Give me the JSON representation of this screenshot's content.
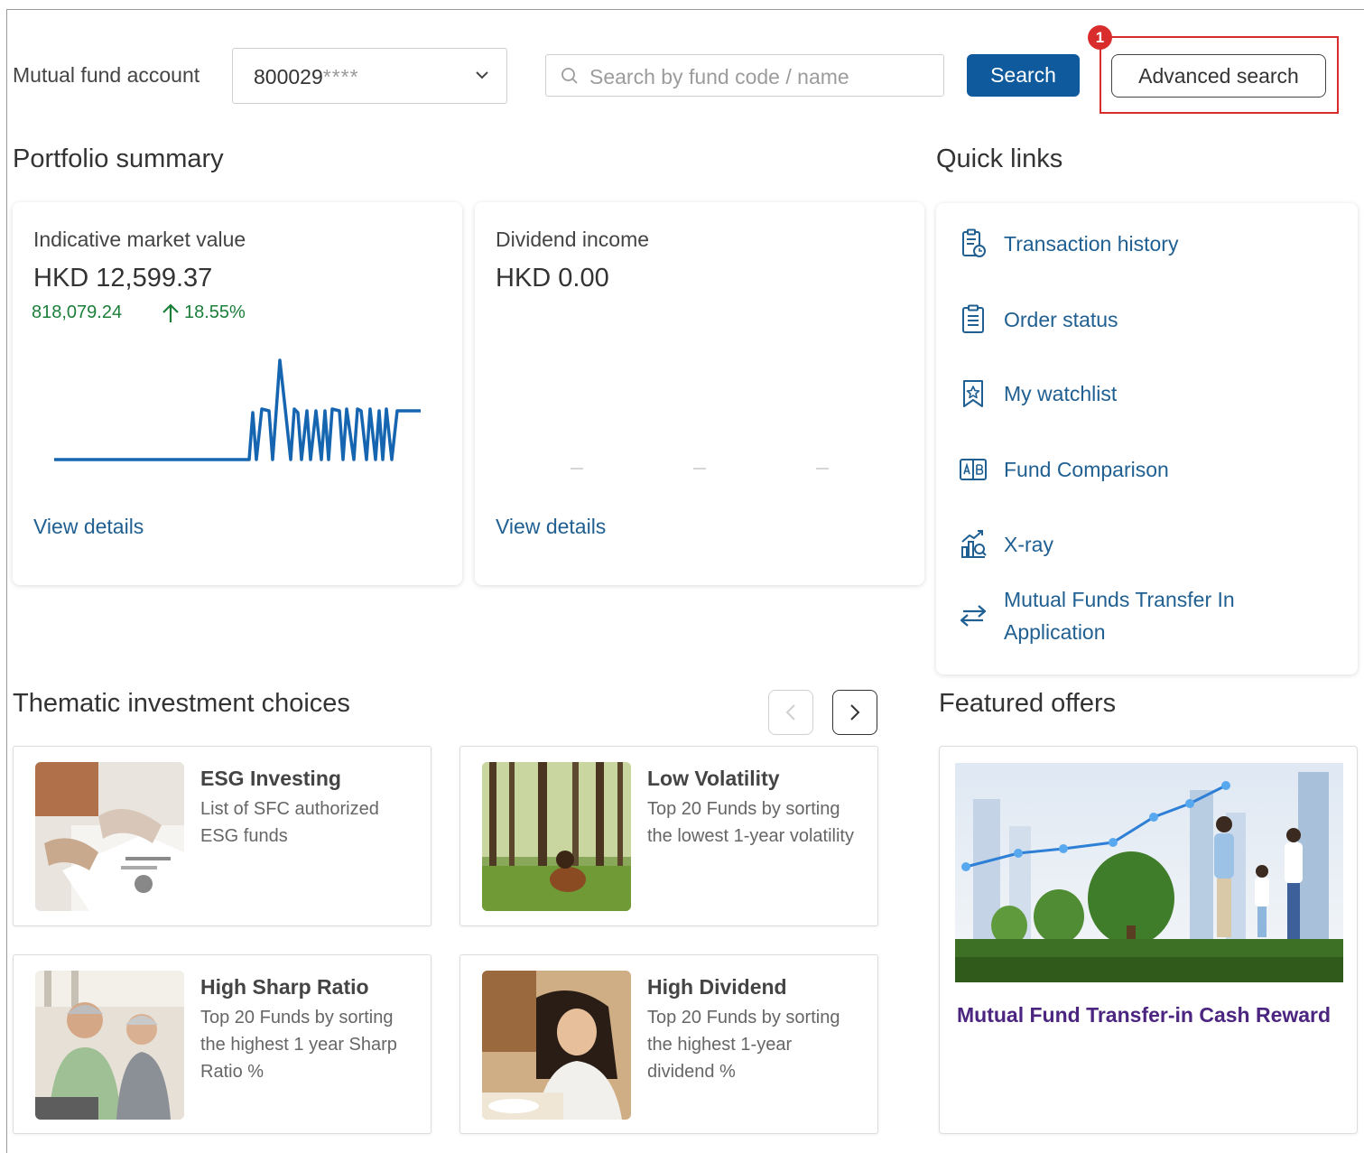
{
  "account": {
    "label": "Mutual fund account",
    "value": "800029",
    "mask": "****"
  },
  "search": {
    "placeholder": "Search by fund code / name",
    "button_label": "Search",
    "advanced_label": "Advanced search",
    "step_number": "1",
    "highlight_color": "#d92c2c"
  },
  "portfolio": {
    "heading": "Portfolio summary",
    "market_value": {
      "title": "Indicative market value",
      "value": "HKD 12,599.37",
      "change": "818,079.24",
      "change_pct": "18.55%",
      "link": "View details"
    },
    "dividend": {
      "title": "Dividend income",
      "value": "HKD 0.00",
      "link": "View details"
    }
  },
  "quick_links": {
    "heading": "Quick links",
    "items": [
      {
        "label": "Transaction history",
        "icon": "transaction-history-icon"
      },
      {
        "label": "Order status",
        "icon": "clipboard-list-icon"
      },
      {
        "label": "My watchlist",
        "icon": "bookmark-star-icon"
      },
      {
        "label": "Fund Comparison",
        "icon": "compare-ab-icon"
      },
      {
        "label": "X-ray",
        "icon": "chart-magnifier-icon"
      },
      {
        "label": "Mutual Funds Transfer In\nApplication",
        "icon": "transfer-arrows-icon"
      }
    ]
  },
  "thematic": {
    "heading": "Thematic investment choices",
    "tiles": [
      {
        "title": "ESG Investing",
        "desc": "List of SFC authorized ESG funds"
      },
      {
        "title": "Low Volatility",
        "desc": "Top 20 Funds by sorting the lowest 1-year volatility"
      },
      {
        "title": "High Sharp Ratio",
        "desc": "Top 20 Funds by sorting the highest 1 year Sharp Ratio %"
      },
      {
        "title": "High Dividend",
        "desc": "Top 20 Funds by sorting the highest 1-year dividend %"
      }
    ]
  },
  "featured": {
    "heading": "Featured offers",
    "offer_title": "Mutual Fund Transfer-in Cash Reward"
  },
  "colors": {
    "primary": "#0e5a9c",
    "link": "#1f5f91",
    "positive": "#1b7f3a",
    "offer": "#4b2580"
  }
}
